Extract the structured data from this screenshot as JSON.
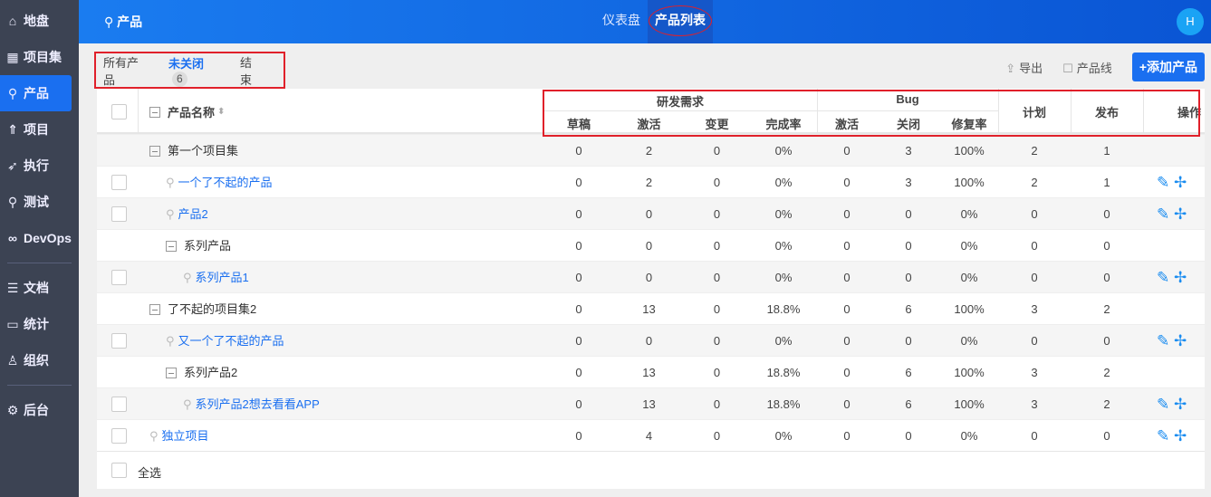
{
  "sidebar": {
    "items": [
      {
        "label": "地盘",
        "icon": "home-icon"
      },
      {
        "label": "项目集",
        "icon": "grid-icon"
      },
      {
        "label": "产品",
        "icon": "bulb-icon",
        "active": true
      },
      {
        "label": "项目",
        "icon": "rocket-icon"
      },
      {
        "label": "执行",
        "icon": "run-icon"
      },
      {
        "label": "测试",
        "icon": "search-icon"
      },
      {
        "label": "DevOps",
        "icon": "infinity-icon"
      },
      {
        "label": "文档",
        "icon": "doc-icon"
      },
      {
        "label": "统计",
        "icon": "chart-icon"
      },
      {
        "label": "组织",
        "icon": "user-icon"
      },
      {
        "label": "后台",
        "icon": "gear-icon"
      }
    ]
  },
  "topbar": {
    "brand": "产品",
    "nav": [
      "仪表盘",
      "产品列表"
    ],
    "avatar": "H"
  },
  "tabs": [
    {
      "label": "所有产品"
    },
    {
      "label": "未关闭",
      "count": "6"
    },
    {
      "label": "结束"
    }
  ],
  "tools": {
    "export": "导出",
    "line": "产品线",
    "add": "+添加产品"
  },
  "table": {
    "name_header": "产品名称",
    "group1": "研发需求",
    "group2": "Bug",
    "sub": [
      "草稿",
      "激活",
      "变更",
      "完成率",
      "激活",
      "关闭",
      "修复率"
    ],
    "plan": "计划",
    "release": "发布",
    "actions": "操作",
    "rows": [
      {
        "type": "group",
        "level": 0,
        "name": "第一个项目集",
        "values": [
          "0",
          "2",
          "0",
          "0%",
          "0",
          "3",
          "100%",
          "2",
          "1"
        ]
      },
      {
        "type": "product",
        "level": 1,
        "name": "一个了不起的产品",
        "values": [
          "0",
          "2",
          "0",
          "0%",
          "0",
          "3",
          "100%",
          "2",
          "1"
        ]
      },
      {
        "type": "product",
        "level": 1,
        "name": "产品2",
        "values": [
          "0",
          "0",
          "0",
          "0%",
          "0",
          "0",
          "0%",
          "0",
          "0"
        ]
      },
      {
        "type": "line",
        "level": 1,
        "name": "系列产品",
        "values": [
          "0",
          "0",
          "0",
          "0%",
          "0",
          "0",
          "0%",
          "0",
          "0"
        ]
      },
      {
        "type": "product",
        "level": 2,
        "name": "系列产品1",
        "values": [
          "0",
          "0",
          "0",
          "0%",
          "0",
          "0",
          "0%",
          "0",
          "0"
        ]
      },
      {
        "type": "group",
        "level": 0,
        "name": "了不起的项目集2",
        "values": [
          "0",
          "13",
          "0",
          "18.8%",
          "0",
          "6",
          "100%",
          "3",
          "2"
        ]
      },
      {
        "type": "product",
        "level": 1,
        "name": "又一个了不起的产品",
        "values": [
          "0",
          "0",
          "0",
          "0%",
          "0",
          "0",
          "0%",
          "0",
          "0"
        ]
      },
      {
        "type": "line",
        "level": 1,
        "name": "系列产品2",
        "values": [
          "0",
          "13",
          "0",
          "18.8%",
          "0",
          "6",
          "100%",
          "3",
          "2"
        ]
      },
      {
        "type": "product",
        "level": 2,
        "name": "系列产品2想去看看APP",
        "values": [
          "0",
          "13",
          "0",
          "18.8%",
          "0",
          "6",
          "100%",
          "3",
          "2"
        ]
      },
      {
        "type": "product",
        "level": 0,
        "name": "独立项目",
        "values": [
          "0",
          "4",
          "0",
          "0%",
          "0",
          "0",
          "0%",
          "0",
          "0"
        ]
      }
    ]
  },
  "footer": {
    "select_all": "全选"
  }
}
